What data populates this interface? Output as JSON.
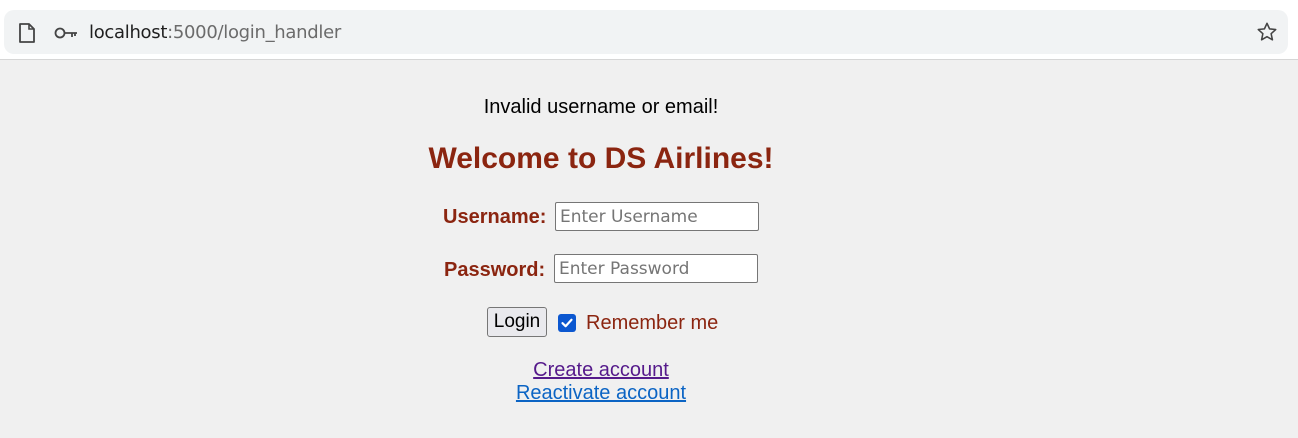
{
  "browser": {
    "url_host": "localhost",
    "url_path": ":5000/login_handler",
    "icons": [
      "page-icon",
      "key-icon",
      "star-icon"
    ]
  },
  "page": {
    "message": "Invalid username or email!",
    "title": "Welcome to DS Airlines!",
    "username_label": "Username:",
    "username_placeholder": "Enter Username",
    "password_label": "Password:",
    "password_placeholder": "Enter Password",
    "login_button": "Login",
    "remember_label": "Remember me",
    "remember_checked": true,
    "create_account_link": "Create account",
    "reactivate_account_link": "Reactivate account"
  },
  "colors": {
    "accent": "#8b2510",
    "checkbox": "#0b57d0",
    "visited_link": "#551a8b",
    "link": "#0b64c4"
  }
}
